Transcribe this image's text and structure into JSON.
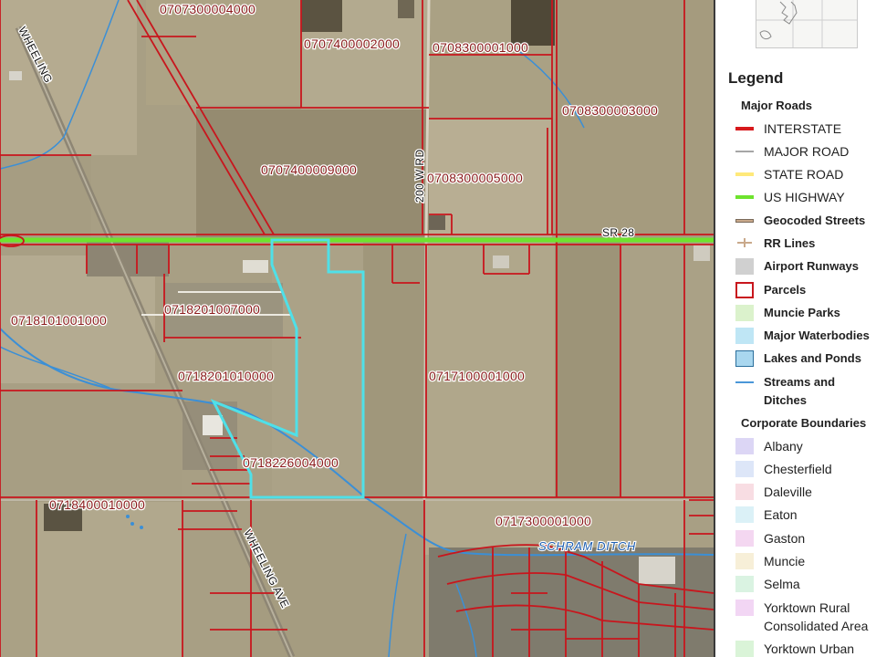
{
  "map": {
    "parcels": [
      {
        "id": "p1",
        "label": "0707300004000"
      },
      {
        "id": "p2",
        "label": "0707400002000"
      },
      {
        "id": "p3",
        "label": "0708300001000"
      },
      {
        "id": "p4",
        "label": "0708300003000"
      },
      {
        "id": "p5",
        "label": "0707400009000"
      },
      {
        "id": "p6",
        "label": "0708300005000"
      },
      {
        "id": "p7",
        "label": "0718201007000"
      },
      {
        "id": "p8",
        "label": "0718101001000"
      },
      {
        "id": "p9",
        "label": "0718201010000"
      },
      {
        "id": "p10",
        "label": "0717100001000"
      },
      {
        "id": "p11",
        "label": "0718226004000"
      },
      {
        "id": "p12",
        "label": "0718400010000"
      },
      {
        "id": "p13",
        "label": "0717300001000"
      }
    ],
    "roads": [
      {
        "id": "wheeling",
        "label": "WHEELING"
      },
      {
        "id": "200wrd",
        "label": "200 W RD"
      },
      {
        "id": "sr28",
        "label": "SR 28"
      },
      {
        "id": "wheelingave",
        "label": "WHEELING AVE"
      }
    ],
    "waterways": [
      {
        "id": "schram",
        "label": "SCHRAM DITCH"
      }
    ],
    "colors": {
      "parcel_boundary": "#c8161d",
      "us_highway": "#6ee32e",
      "selected_parcel": "#4fe0e8",
      "stream": "#3b8fd6"
    }
  },
  "legend": {
    "title": "Legend",
    "groups": [
      {
        "heading": "Major Roads",
        "items": [
          {
            "label": "INTERSTATE",
            "swatch": "line",
            "color": "#d7191c"
          },
          {
            "label": "MAJOR ROAD",
            "swatch": "line",
            "color": "#a6a6a6"
          },
          {
            "label": "STATE ROAD",
            "swatch": "line",
            "color": "#ffe97a"
          },
          {
            "label": "US HIGHWAY",
            "swatch": "line",
            "color": "#6ee32e"
          },
          {
            "label": "Geocoded Streets",
            "swatch": "line-outlined",
            "color": "#c9a98b"
          },
          {
            "label": "RR Lines",
            "swatch": "rr",
            "color": "#c9a98b"
          },
          {
            "label": "Airport Runways",
            "swatch": "box",
            "color": "#d0d0d0"
          },
          {
            "label": "Parcels",
            "swatch": "box-outline",
            "color": "#c8161d"
          },
          {
            "label": "Muncie Parks",
            "swatch": "box",
            "color": "#dbf2cc"
          },
          {
            "label": "Major Waterbodies",
            "swatch": "box",
            "color": "#bfe6f5"
          },
          {
            "label": "Lakes and Ponds",
            "swatch": "box-stroke",
            "color": "#a9d7ef"
          },
          {
            "label": "Streams and Ditches",
            "swatch": "line-thin",
            "color": "#4a97d8"
          }
        ]
      },
      {
        "heading": "Corporate Boundaries",
        "items": [
          {
            "label": "Albany",
            "swatch": "box",
            "color": "#dcd6f5"
          },
          {
            "label": "Chesterfield",
            "swatch": "box",
            "color": "#dde6f8"
          },
          {
            "label": "Daleville",
            "swatch": "box",
            "color": "#f8dde3"
          },
          {
            "label": "Eaton",
            "swatch": "box",
            "color": "#dbf1f7"
          },
          {
            "label": "Gaston",
            "swatch": "box",
            "color": "#f4d7f1"
          },
          {
            "label": "Muncie",
            "swatch": "box",
            "color": "#f7efd8"
          },
          {
            "label": "Selma",
            "swatch": "box",
            "color": "#daf3e2"
          },
          {
            "label": "Yorktown Rural Consolidated Area",
            "swatch": "box",
            "color": "#f2d6f4"
          },
          {
            "label": "Yorktown Urban",
            "swatch": "box",
            "color": "#daf4d8"
          }
        ]
      }
    ]
  }
}
